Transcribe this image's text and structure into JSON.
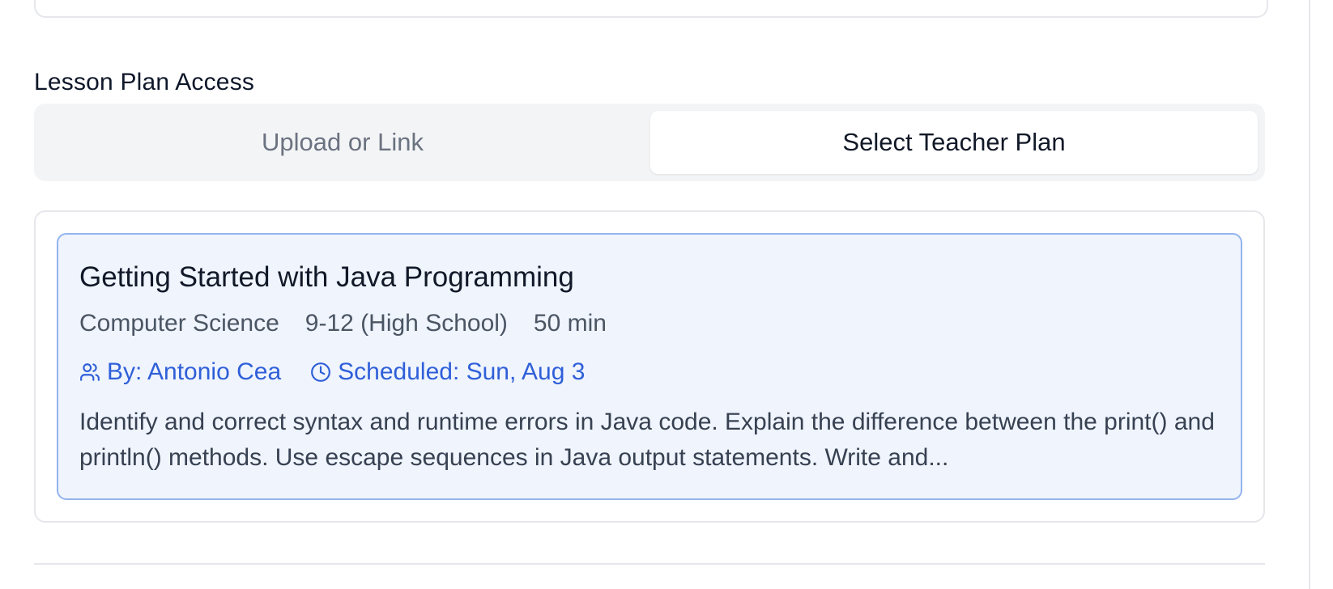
{
  "section": {
    "label": "Lesson Plan Access"
  },
  "tabs": [
    {
      "label": "Upload or Link",
      "active": false
    },
    {
      "label": "Select Teacher Plan",
      "active": true
    }
  ],
  "plan": {
    "title": "Getting Started with Java Programming",
    "subject": "Computer Science",
    "grade": "9-12 (High School)",
    "duration": "50 min",
    "author": "By: Antonio Cea",
    "scheduled": "Scheduled: Sun, Aug 3",
    "description": "Identify and correct syntax and runtime errors in Java code. Explain the difference between the print() and println() methods. Use escape sequences in Java output statements. Write and...",
    "author_icon": "users-icon",
    "scheduled_icon": "clock-icon"
  },
  "colors": {
    "accent": "#2f5fd8",
    "card_bg": "#eff4fd",
    "card_border": "#93b4ee"
  }
}
